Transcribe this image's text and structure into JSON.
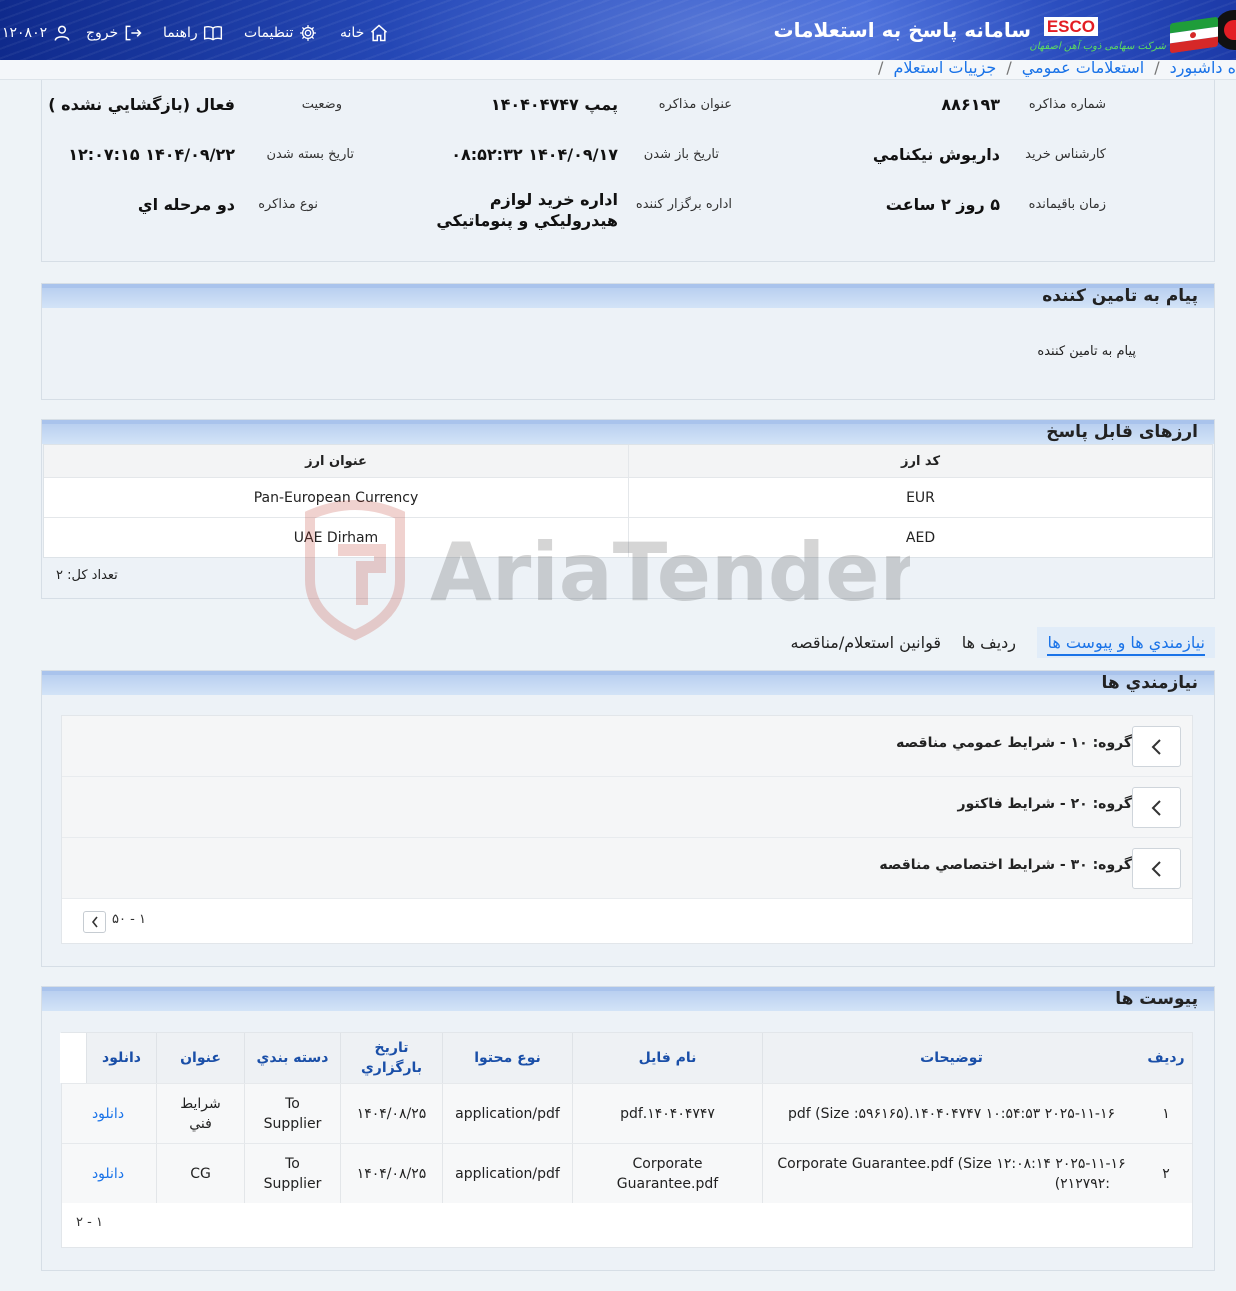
{
  "header": {
    "app_title": "سامانه پاسخ به استعلامات",
    "brand": "ESCO",
    "brand_subtitle": "شرکت سهامی ذوب آهن اصفهان",
    "nav": {
      "home": "خانه",
      "settings": "تنظیمات",
      "help": "راهنما",
      "logout": "خروج",
      "user_id": "۱۲۰۸۰۲"
    }
  },
  "breadcrumb": {
    "dashboard": "ه داشبورد",
    "public": "استعلامات عمومي",
    "current": "جزييات استعلام"
  },
  "details": {
    "fields": [
      {
        "label": "شماره مذاکره",
        "value": "۸۸۶۱۹۳"
      },
      {
        "label": "عنوان مذاکره",
        "value": "پمپ ۱۴۰۴۰۴۷۴۷"
      },
      {
        "label": "وضعيت",
        "value": "فعال (بازگشايي نشده )"
      },
      {
        "label": "کارشناس خريد",
        "value": "داريوش نيکنامي"
      },
      {
        "label": "تاريخ باز شدن",
        "value": "۱۴۰۴/۰۹/۱۷ ۰۸:۵۲:۳۲"
      },
      {
        "label": "تاريخ بسته شدن",
        "value": "۱۴۰۴/۰۹/۲۲ ۱۲:۰۷:۱۵"
      },
      {
        "label": "زمان باقيمانده",
        "value": "۵ روز ۲ ساعت"
      },
      {
        "label": "اداره برگزار کننده",
        "value_line1": "اداره خريد لوازم",
        "value_line2": "هيدروليکي و پنوماتيکي"
      },
      {
        "label": "نوع مذاکره",
        "value": "دو مرحله اي"
      }
    ]
  },
  "supplier_message": {
    "title": "پيام به تامين کننده",
    "body": "پيام به تامين کننده"
  },
  "currencies": {
    "title": "ارزهای قابل پاسخ",
    "columns": {
      "code": "کد ارز",
      "name": "عنوان ارز"
    },
    "rows": [
      {
        "code": "EUR",
        "name": "Pan-European Currency"
      },
      {
        "code": "AED",
        "name": "UAE Dirham"
      }
    ],
    "total": "تعداد کل: ۲"
  },
  "tabs": {
    "requirements": "نيازمندي ها و پيوست ها",
    "rows": "رديف ها",
    "rules": "قوانين استعلام/مناقصه"
  },
  "requirements": {
    "title": "نيازمندي ها",
    "groups": [
      {
        "label": "گروه: ۱۰ - شرايط عمومي مناقصه"
      },
      {
        "label": "گروه: ۲۰ - شرايط فاکتور"
      },
      {
        "label": "گروه: ۳۰ - شرايط اختصاصي مناقصه"
      }
    ],
    "pager": "۱ - ۵۰"
  },
  "attachments": {
    "title": "پيوست ها",
    "columns": {
      "row": "رديف",
      "desc": "توضيحات",
      "file": "نام فايل",
      "mime": "نوع محتوا",
      "date": "تاريخ بارگزاري",
      "category": "دسته بندي",
      "title": "عنوان",
      "download": "دانلود"
    },
    "rows": [
      {
        "row": "۱",
        "desc": "۲۰۲۵-۱۱-۱۶ ۱۰:۵۴:۵۳ ۱۴۰۴۰۴۷۴۷.pdf (Size :۵۹۶۱۶۵)",
        "file": "۱۴۰۴۰۴۷۴۷.pdf",
        "mime": "application/pdf",
        "date": "۱۴۰۴/۰۸/۲۵",
        "category_line1": "To",
        "category_line2": "Supplier",
        "title_line1": "شرايط",
        "title_line2": "فني",
        "download": "دانلود"
      },
      {
        "row": "۲",
        "desc_line1": "۲۰۲۵-۱۱-۱۶ ۱۲:۰۸:۱۴ Corporate Guarantee.pdf (Size",
        "desc_line2": ":۲۱۲۷۹۲)",
        "file_line1": "Corporate",
        "file_line2": "Guarantee.pdf",
        "mime": "application/pdf",
        "date": "۱۴۰۴/۰۸/۲۵",
        "category_line1": "To",
        "category_line2": "Supplier",
        "title": "CG",
        "download": "دانلود"
      }
    ],
    "pager": "۱ - ۲"
  },
  "watermark": {
    "text": "AriaTender.neT"
  },
  "colors": {
    "accent": "#1a73e8",
    "header_blue": "#2a4fc0",
    "brand_red": "#e31d24"
  }
}
